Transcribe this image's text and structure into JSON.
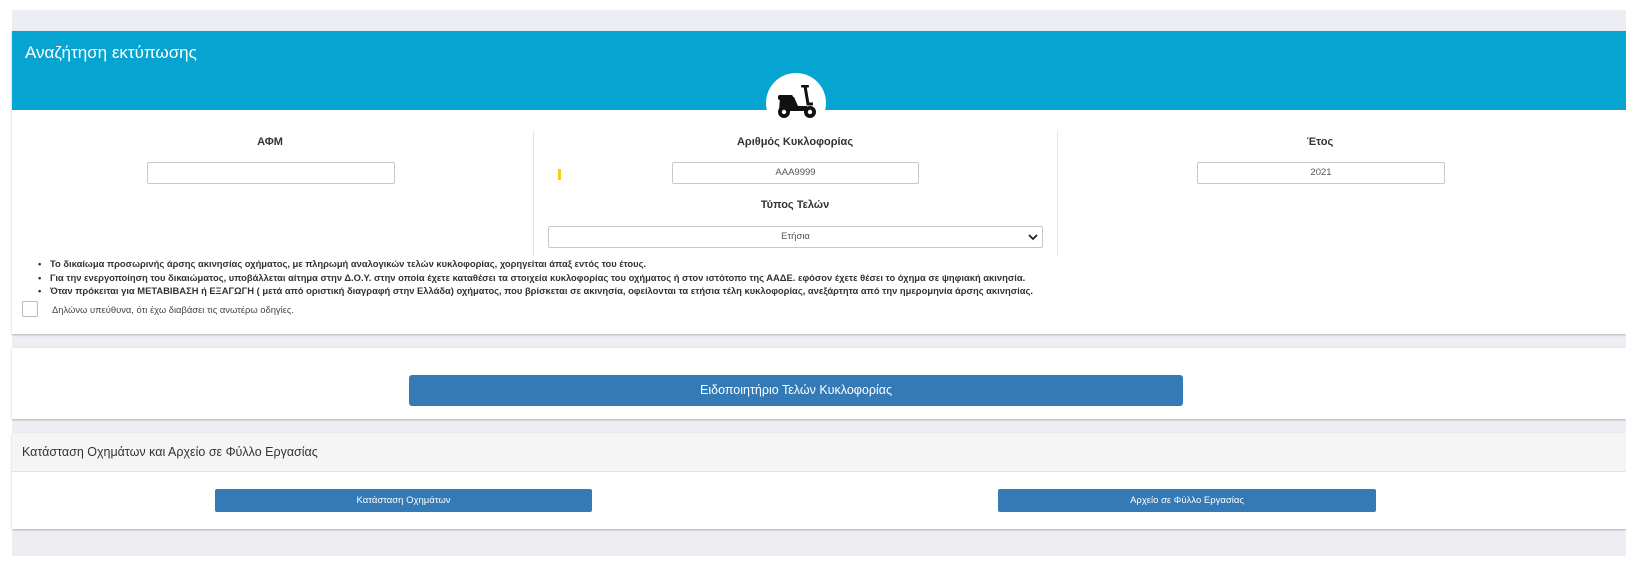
{
  "search_panel": {
    "title": "Αναζήτηση εκτύπωσης",
    "vehicle_icon": "scooter-icon",
    "header_color": "#06a4d0",
    "afm": {
      "label": "ΑΦΜ",
      "value": ""
    },
    "plate": {
      "label": "Αριθμός Κυκλοφορίας",
      "value": "AAA9999"
    },
    "year": {
      "label": "Έτος",
      "value": "2021"
    },
    "fee_type": {
      "label": "Τύπος Τελών",
      "selected": "Ετήσια"
    },
    "notes": [
      "Το δικαίωμα προσωρινής άρσης ακινησίας οχήματος, με πληρωμή αναλογικών τελών κυκλοφορίας, χορηγείται άπαξ εντός του έτους.",
      "Για την ενεργοποίηση του δικαιώματος, υποβάλλεται αίτημα στην Δ.Ο.Υ. στην οποία έχετε καταθέσει τα στοιχεία κυκλοφορίας του οχήματος ή στον ιστότοπο της ΑΑΔΕ. εφόσον έχετε θέσει το όχημα σε ψηφιακή ακινησία.",
      "Όταν πρόκειται για ΜΕΤΑΒΙΒΑΣΗ ή ΕΞΑΓΩΓΗ ( μετά από οριστική διαγραφή στην Ελλάδα) οχήματος, που βρίσκεται σε ακινησία, οφείλονται τα ετήσια τέλη κυκλοφορίας, ανεξάρτητα από την ημερομηνία άρσης ακινησίας."
    ],
    "declaration": {
      "label": "Δηλώνω υπεύθυνα, ότι έχω διαβάσει τις ανωτέρω οδηγίες.",
      "checked": false
    }
  },
  "actions": {
    "notice_button": "Ειδοποιητήριο Τελών Κυκλοφορίας",
    "button_color": "#337ab7"
  },
  "status_panel": {
    "title": "Κατάσταση Οχημάτων και Αρχείο σε Φύλλο Εργασίας",
    "vehicles_button": "Κατάσταση Οχημάτων",
    "spreadsheet_button": "Αρχείο σε Φύλλο Εργασίας"
  }
}
